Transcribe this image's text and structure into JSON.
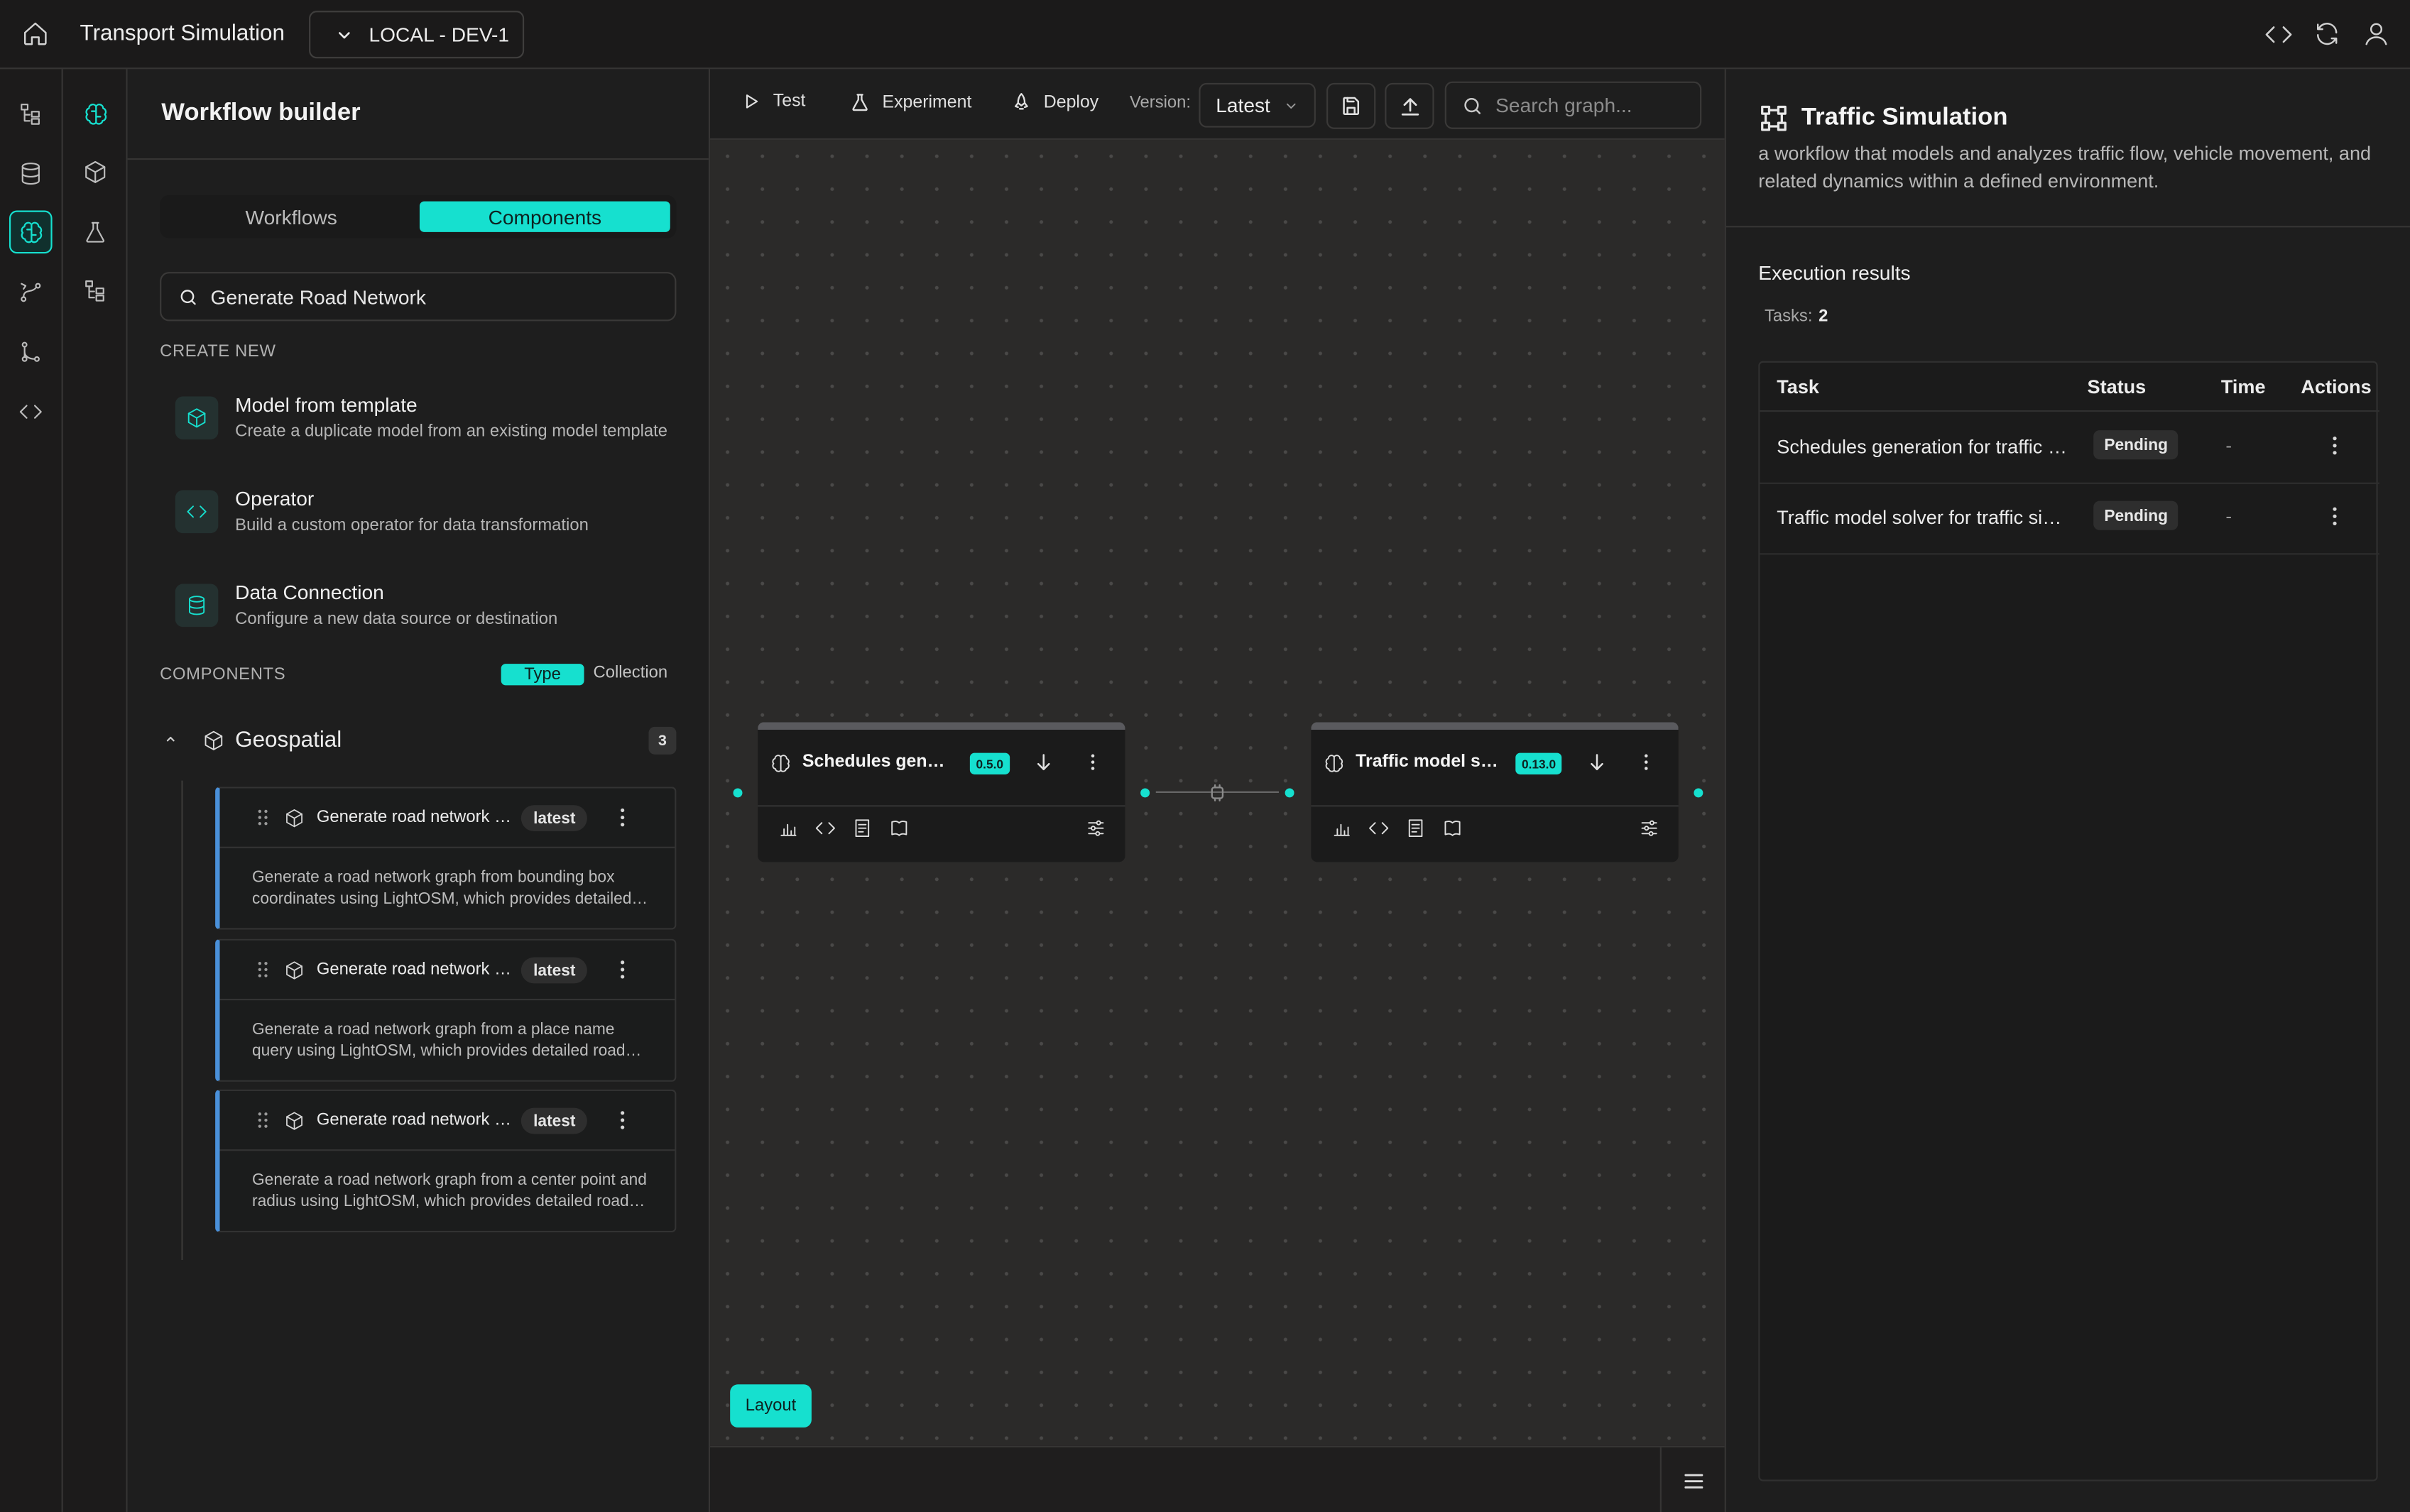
{
  "app": {
    "title": "Transport Simulation",
    "environment": "LOCAL - DEV-1"
  },
  "colors": {
    "accent": "#16e0cf",
    "background": "#1c1b1b",
    "canvas": "#2b2a29",
    "card_border_left": "#4a90d9"
  },
  "topbar_icons": [
    "home-icon",
    "code-icon",
    "refresh-icon",
    "user-icon"
  ],
  "rail": {
    "primary_icons": [
      "hierarchy-icon",
      "database-icon",
      "brain-icon",
      "flow-icon",
      "git-branch-icon",
      "code-icon"
    ],
    "secondary_icons": [
      "brain-icon",
      "cube-icon",
      "flask-icon",
      "hierarchy-icon"
    ],
    "active": "brain-icon"
  },
  "left_panel": {
    "title": "Workflow builder",
    "tabs": [
      "Workflows",
      "Components"
    ],
    "active_tab": "Components",
    "search_value": "Generate Road Network",
    "create_new_heading": "CREATE NEW",
    "create_new": [
      {
        "title": "Model from template",
        "description": "Create a duplicate model from an existing model template",
        "icon": "cube-icon"
      },
      {
        "title": "Operator",
        "description": "Build a custom operator for data transformation",
        "icon": "code-icon"
      },
      {
        "title": "Data Connection",
        "description": "Configure a new data source or destination",
        "icon": "database-icon"
      }
    ],
    "components_heading": "COMPONENTS",
    "grouping": {
      "options": [
        "Type",
        "Collection"
      ],
      "active": "Type"
    },
    "group": {
      "name": "Geospatial",
      "count": "3",
      "expanded": true
    },
    "components": [
      {
        "name": "Generate road network from bounding box",
        "version": "latest",
        "description": "Generate a road network graph from bounding box coordinates using LightOSM, which provides detailed road network data."
      },
      {
        "name": "Generate road network from place",
        "version": "latest",
        "description": "Generate a road network graph from a place name query using LightOSM, which provides detailed road network data."
      },
      {
        "name": "Generate road network from point",
        "version": "latest",
        "description": "Generate a road network graph from a center point and radius using LightOSM, which provides detailed road network data."
      }
    ]
  },
  "toolbar": {
    "test": "Test",
    "experiment": "Experiment",
    "deploy": "Deploy",
    "version_label": "Version:",
    "version_value": "Latest",
    "search_placeholder": "Search graph..."
  },
  "canvas": {
    "nodes": [
      {
        "title": "Schedules generation for traffic simulation",
        "version": "0.5.0"
      },
      {
        "title": "Traffic model solver for traffic simulation",
        "version": "0.13.0"
      }
    ],
    "layout_button": "Layout"
  },
  "right_panel": {
    "title": "Traffic Simulation",
    "description": "a workflow that models and analyzes traffic flow, vehicle movement, and related dynamics within a defined environment.",
    "execution_title": "Execution results",
    "tasks_label": "Tasks:",
    "tasks_count": "2",
    "columns": [
      "Task",
      "Status",
      "Time",
      "Actions"
    ],
    "rows": [
      {
        "task": "Schedules generation for traffic simulation",
        "status": "Pending",
        "time": "-"
      },
      {
        "task": "Traffic model solver for traffic simulation",
        "status": "Pending",
        "time": "-"
      }
    ]
  }
}
